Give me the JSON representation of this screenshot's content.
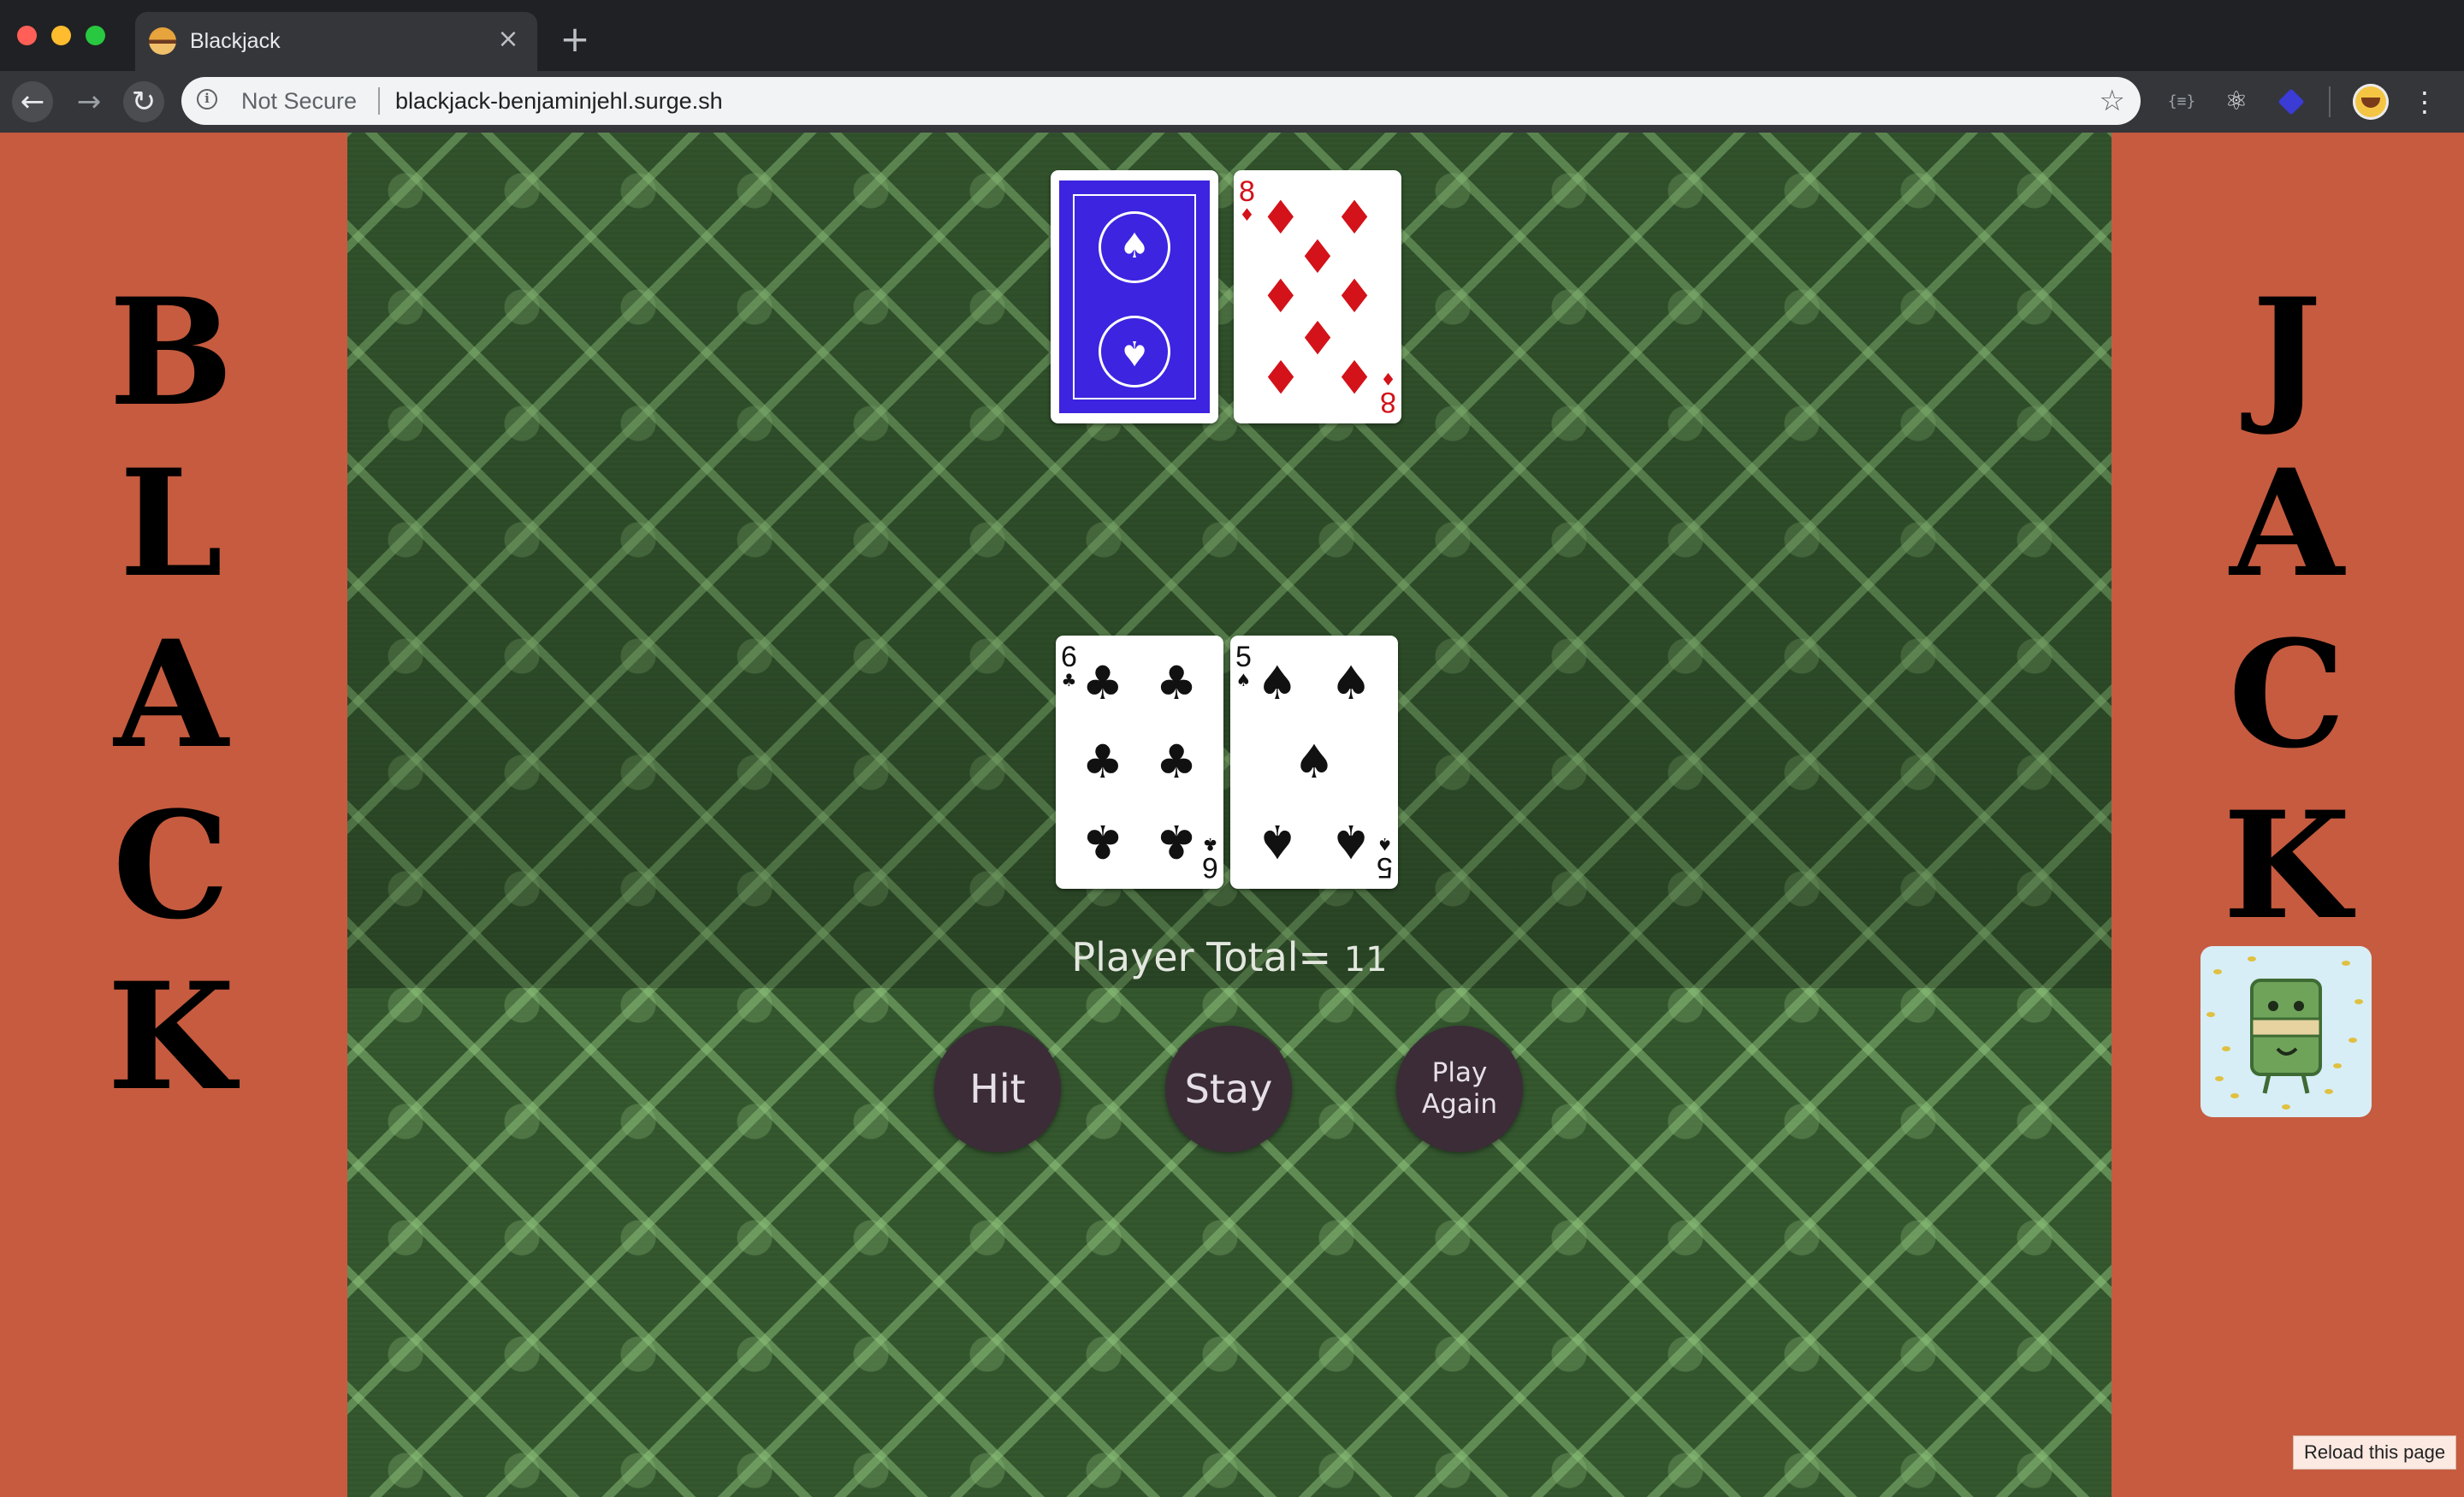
{
  "browser": {
    "tab_title": "Blackjack",
    "tab_close": "×",
    "new_tab": "+",
    "nav_back": "←",
    "nav_forward": "→",
    "nav_reload": "↻",
    "security_label": "Not Secure",
    "url": "blackjack-benjaminjehl.surge.sh",
    "star": "☆",
    "menu": "⋮",
    "ext_1": "{≡}",
    "ext_2": "⚛"
  },
  "sidebar_left": {
    "letters": [
      "B",
      "L",
      "A",
      "C",
      "K"
    ]
  },
  "sidebar_right": {
    "letters": [
      "J",
      "A",
      "C",
      "K"
    ]
  },
  "dealer": {
    "cards": [
      {
        "face": "down",
        "icon": "card-back"
      },
      {
        "face": "up",
        "rank": "8",
        "suit": "♦",
        "color": "#d3121a"
      }
    ]
  },
  "player": {
    "cards": [
      {
        "face": "up",
        "rank": "6",
        "suit": "♣",
        "color": "#111111"
      },
      {
        "face": "up",
        "rank": "5",
        "suit": "♠",
        "color": "#111111"
      }
    ],
    "total_label": "Player Total= ",
    "total_value": "11"
  },
  "controls": {
    "hit": "Hit",
    "stay": "Stay",
    "play_again": "Play Again"
  },
  "reload_tooltip": "Reload this page",
  "colors": {
    "side_panel": "#c65b3f",
    "felt": "#35582f",
    "button": "#3b2c37",
    "card_back": "#3c24e0"
  }
}
